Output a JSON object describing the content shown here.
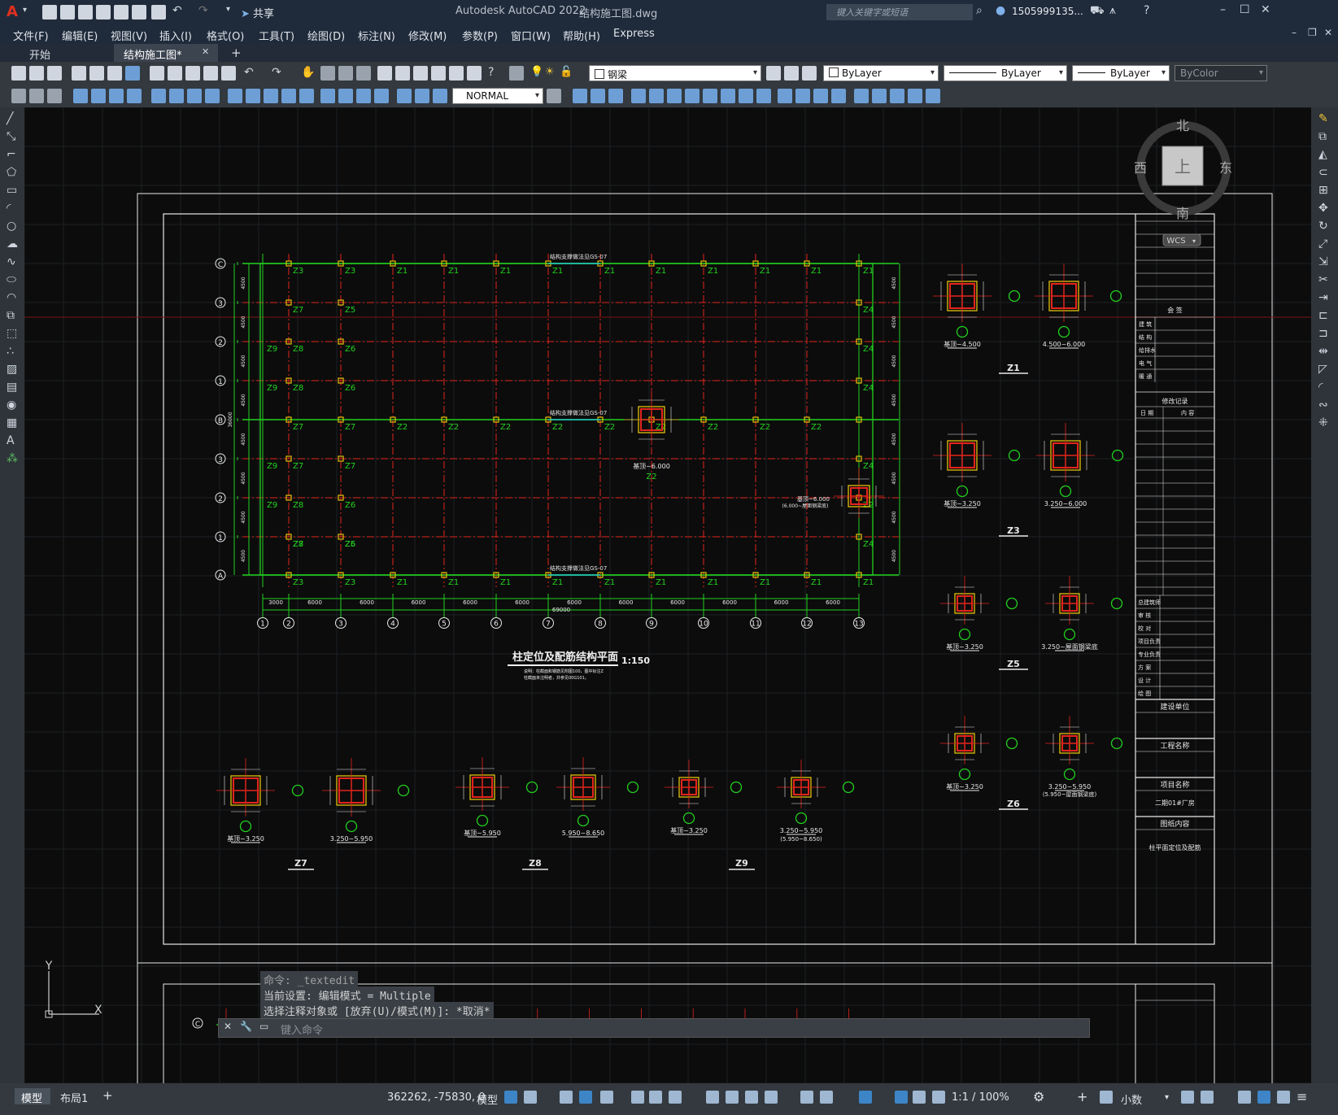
{
  "titlebar": {
    "app_title": "Autodesk AutoCAD 2022",
    "file_name": "结构施工图.dwg",
    "share_label": "共享",
    "search_placeholder": "键入关键字或短语",
    "user": "1505999135...",
    "app_letter": "A"
  },
  "menu": [
    "文件(F)",
    "编辑(E)",
    "视图(V)",
    "插入(I)",
    "格式(O)",
    "工具(T)",
    "绘图(D)",
    "标注(N)",
    "修改(M)",
    "参数(P)",
    "窗口(W)",
    "帮助(H)",
    "Express"
  ],
  "tabs": {
    "start": "开始",
    "active": "结构施工图*",
    "add": "+"
  },
  "toolbar": {
    "layer_name": "钢梁",
    "color": "ByLayer",
    "linetype": "ByLayer",
    "lineweight": "ByLayer",
    "plotstyle": "ByColor",
    "dimstyle": "NORMAL"
  },
  "viewcube": {
    "north": "北",
    "south": "南",
    "east": "东",
    "west": "西",
    "top": "上",
    "wcs": "WCS"
  },
  "drawing": {
    "plan_title": "柱定位及配筋结构平面",
    "plan_scale": "1:150",
    "plan_note1": "说明：柱截面和钢筋见附图100，图中标注Z",
    "plan_note2": "柱截面未注明者，并参见00G101。",
    "gs_label": "结构支撑做法见GS-07",
    "row_labels": [
      "C",
      "3",
      "2",
      "1",
      "B",
      "3",
      "2",
      "1",
      "A"
    ],
    "col_labels": [
      "1",
      "2",
      "3",
      "4",
      "5",
      "6",
      "7",
      "8",
      "9",
      "10",
      "11",
      "12",
      "13"
    ],
    "col_dims": [
      "3000",
      "6000",
      "6000",
      "6000",
      "6000",
      "6000",
      "6000",
      "6000",
      "6000",
      "6000",
      "6000",
      "6000"
    ],
    "total_dim": "69000",
    "row_dim": "4500",
    "total_row_dim": "36000",
    "col_tags_top": [
      "Z3",
      "Z3",
      "Z1",
      "Z1",
      "Z1",
      "Z1",
      "Z1",
      "Z1",
      "Z1",
      "Z1",
      "Z1",
      "Z1"
    ],
    "col_tags_mid": [
      "Z7",
      "Z7",
      "Z2",
      "Z2",
      "Z2",
      "Z2",
      "Z2",
      "Z2",
      "Z2",
      "Z2",
      "Z2"
    ],
    "col_tags_bot": [
      "Z3",
      "Z3",
      "Z1",
      "Z1",
      "Z1",
      "Z1",
      "Z1",
      "Z1",
      "Z1",
      "Z1",
      "Z1",
      "Z1"
    ],
    "z2_label": "基顶~6.000",
    "z4_label1": "基顶~6.000",
    "z4_label2": "(6.000~屋面钢梁底)",
    "side_tags": [
      "Z7",
      "Z5",
      "Z8",
      "Z6",
      "Z8",
      "Z6",
      "Z7",
      "Z7",
      "Z8",
      "Z6",
      "Z8",
      "Z6",
      "Z7",
      "Z5",
      "Z9",
      "Z9",
      "Z9",
      "Z9"
    ],
    "right_tags": [
      "Z4",
      "Z4",
      "Z4",
      "Z4",
      "Z2",
      "Z4",
      "Z4",
      "Z4",
      "Z4",
      "Z4"
    ],
    "sections_right": [
      {
        "name": "Z1",
        "a": "基顶~4.500",
        "b": "4.500~6.000"
      },
      {
        "name": "Z3",
        "a": "基顶~3.250",
        "b": "3.250~6.000"
      },
      {
        "name": "Z5",
        "a": "基顶~3.250",
        "b": "3.250~屋面钢梁底"
      },
      {
        "name": "Z6",
        "a": "基顶~3.250",
        "b": "3.250~5.950",
        "c": "(5.950~屋面钢梁底)"
      }
    ],
    "sections_bottom": [
      {
        "name": "Z7",
        "a": "基顶~3.250",
        "b": "3.250~5.950"
      },
      {
        "name": "Z8",
        "a": "基顶~5.950",
        "b": "5.950~8.650"
      },
      {
        "name": "Z9",
        "a": "基顶~3.250",
        "b": "3.250~5.950",
        "c": "(5.950~8.650)"
      }
    ],
    "titleblock": {
      "sign": "会 签",
      "rows": [
        "建 筑",
        "结 构",
        "给排水",
        "电 气",
        "暖 通"
      ],
      "rev": "修改记录",
      "rev_cols": [
        "日 期",
        "内 容"
      ],
      "roles": [
        "总建筑师",
        "审 核",
        "校 对",
        "项目负责",
        "专业负责",
        "方 案",
        "设 计",
        "绘 图"
      ],
      "unit": "建设单位",
      "proj_name_label": "工程名称",
      "item_name_label": "项目名称",
      "item_name": "二期01#厂房",
      "drawing_content_label": "图纸内容",
      "drawing_content": "柱平面定位及配筋"
    }
  },
  "commandline": {
    "line1": "命令: _textedit",
    "line2": "当前设置: 编辑模式 = Multiple",
    "line3": "选择注释对象或 [放弃(U)/模式(M)]: *取消*",
    "input_placeholder": "键入命令"
  },
  "ucs": {
    "x": "X",
    "y": "Y"
  },
  "status": {
    "tab_model": "模型",
    "tab_layout": "布局1",
    "coords": "362262, -75830, 0",
    "space": "模型",
    "scale": "1:1 / 100%",
    "units": "小数"
  },
  "colors": {
    "red": "#e3241c",
    "green": "#22d11f",
    "yellow": "#e2c00a",
    "cyan": "#21c6c6",
    "white": "#f0f0f0"
  }
}
